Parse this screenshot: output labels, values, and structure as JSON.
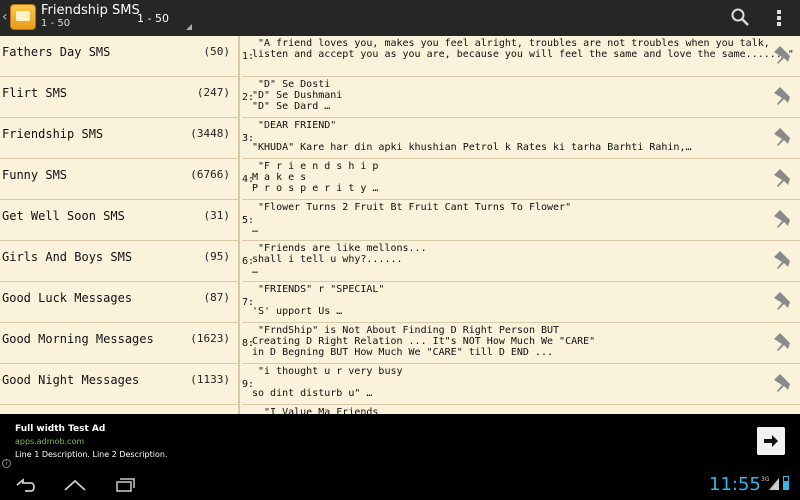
{
  "app": {
    "title": "Friendship SMS",
    "subtitle": "1 - 50",
    "range": "1 - 50"
  },
  "categories": [
    {
      "name": "Fathers Day SMS",
      "count": "(50)"
    },
    {
      "name": "Flirt SMS",
      "count": "(247)"
    },
    {
      "name": "Friendship SMS",
      "count": "(3448)"
    },
    {
      "name": "Funny SMS",
      "count": "(6766)"
    },
    {
      "name": "Get Well Soon SMS",
      "count": "(31)"
    },
    {
      "name": "Girls And Boys SMS",
      "count": "(95)"
    },
    {
      "name": "Good Luck Messages",
      "count": "(87)"
    },
    {
      "name": "Good Morning Messages",
      "count": "(1623)"
    },
    {
      "name": "Good Night Messages",
      "count": "(1133)"
    }
  ],
  "messages": [
    {
      "num": "1:",
      "lines": [
        " \"A friend loves you, makes you feel alright, troubles are not troubles when you talk,",
        "listen and accept you as you are, because you will feel the same and love the same.......\"",
        ""
      ]
    },
    {
      "num": "2:",
      "lines": [
        " \"D\" Se Dosti",
        "\"D\" Se Dushmani",
        "\"D\" Se Dard …"
      ]
    },
    {
      "num": "3:",
      "lines": [
        " \"DEAR FRIEND\"",
        "",
        "\"KHUDA\" Kare har din apki khushian Petrol k Rates ki tarha Barhti Rahin,…"
      ]
    },
    {
      "num": "4:",
      "lines": [
        " \"F r i e n d s h i p",
        "M a k e s",
        "P r o s p e r i t y …"
      ]
    },
    {
      "num": "5:",
      "lines": [
        " \"Flower Turns 2 Fruit Bt Fruit Cant Turns To Flower\"",
        "",
        "…"
      ]
    },
    {
      "num": "6:",
      "lines": [
        " \"Friends are like mellons...",
        "shall i tell u why?......",
        "…"
      ]
    },
    {
      "num": "7:",
      "lines": [
        " \"FRIENDS\" r \"SPECIAL\"",
        "",
        "'S' upport Us …"
      ]
    },
    {
      "num": "8:",
      "lines": [
        " \"FrndShip\" is Not About Finding D Right Person BUT",
        "Creating D Right Relation ... It\"s NOT How Much We \"CARE\"",
        "in D Begning BUT How Much We \"CARE\" till D END ..."
      ]
    },
    {
      "num": "9:",
      "lines": [
        " \"i thought u r very busy",
        "",
        "so dint disturb u\" …"
      ]
    },
    {
      "num": "",
      "lines": [
        "  \"I Value Ma Friends",
        "",
        ""
      ]
    }
  ],
  "ad": {
    "title": "Full width Test Ad",
    "url": "apps.admob.com",
    "description": "Line 1 Description. Line 2 Description.",
    "info": "i"
  },
  "status": {
    "time": "11:55",
    "network": "3G"
  },
  "colors": {
    "background": "#fbf2dc",
    "clock": "#33b5e5",
    "ad_url": "#7bc043"
  }
}
